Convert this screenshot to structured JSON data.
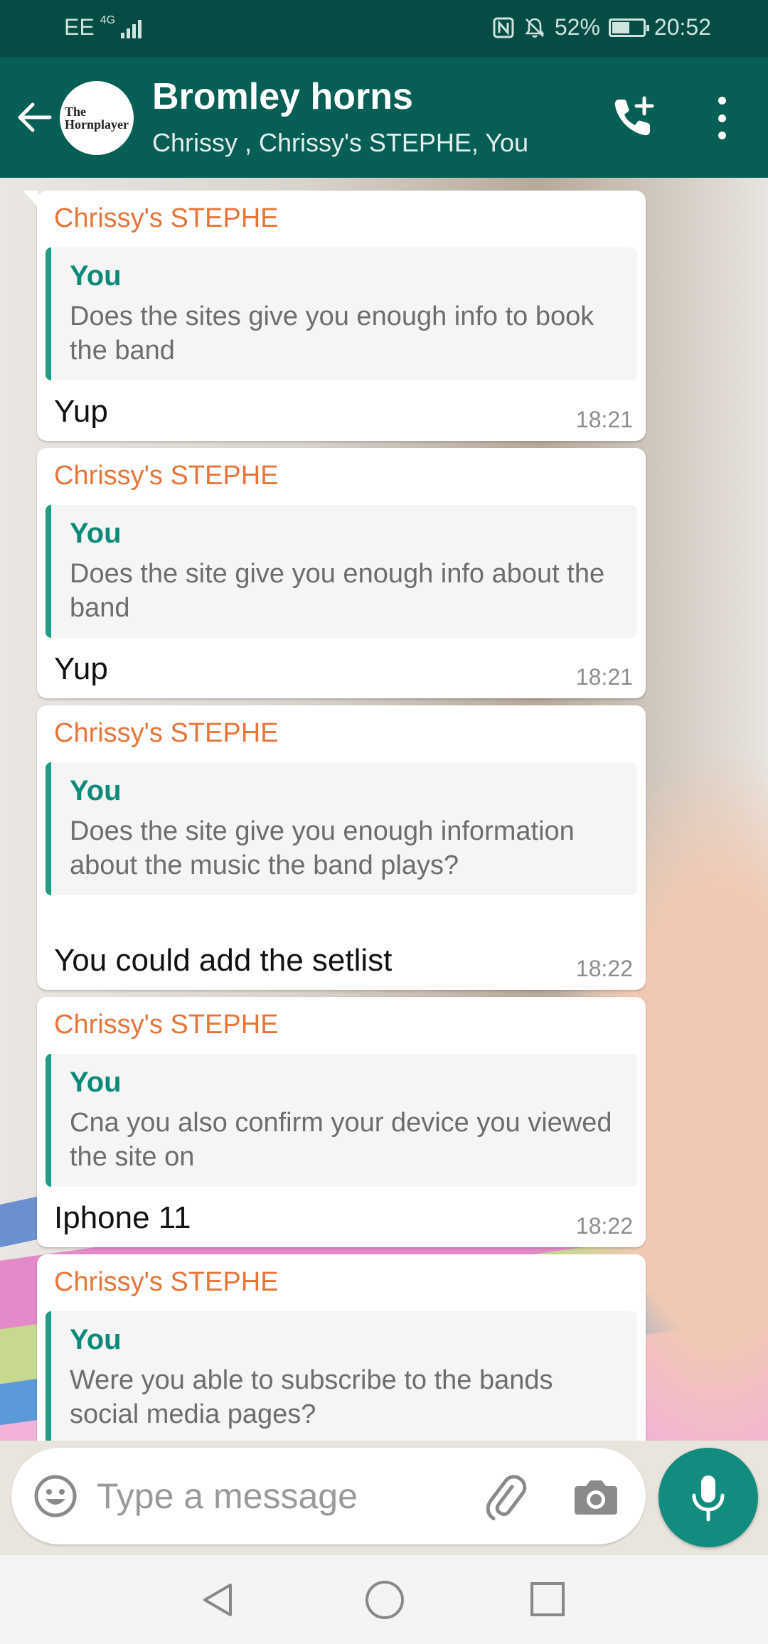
{
  "status_bar": {
    "carrier": "EE",
    "network": "4G",
    "battery": "52%",
    "battery_level": 0.52,
    "time": "20:52"
  },
  "header": {
    "title": "Bromley horns",
    "members": "Chrissy , Chrissy's STEPHE, You",
    "avatar_logo_line1": "The",
    "avatar_logo_line2": "Hornplayer"
  },
  "messages": [
    {
      "sender": "Chrissy's STEPHE",
      "quote_author": "You",
      "quote_text": "Does the sites give you enough info to book the band",
      "text": "Yup",
      "time": "18:21"
    },
    {
      "sender": "Chrissy's STEPHE",
      "quote_author": "You",
      "quote_text": "Does the site give you enough info about the band",
      "text": "Yup",
      "time": "18:21"
    },
    {
      "sender": "Chrissy's STEPHE",
      "quote_author": "You",
      "quote_text": "Does the site give you enough information about the music the band plays?",
      "text": "You could add the setlist",
      "time": "18:22"
    },
    {
      "sender": "Chrissy's STEPHE",
      "quote_author": "You",
      "quote_text": "Cna you also confirm your device you viewed the site on",
      "text": "Iphone 11",
      "time": "18:22"
    },
    {
      "sender": "Chrissy's STEPHE",
      "quote_author": "You",
      "quote_text": "Were you able to subscribe to the bands social media pages?"
    }
  ],
  "composer": {
    "placeholder": "Type a message"
  },
  "icons": {
    "back": "arrow-left-icon",
    "call": "add-call-icon",
    "menu": "more-vertical-icon",
    "emoji": "emoji-icon",
    "attach": "paperclip-icon",
    "camera": "camera-icon",
    "mic": "microphone-icon"
  },
  "colors": {
    "header": "#075e54",
    "status_bar": "#054c44",
    "sender": "#e6753a",
    "quote_accent": "#1a9e84",
    "mic_button": "#128c7e"
  }
}
